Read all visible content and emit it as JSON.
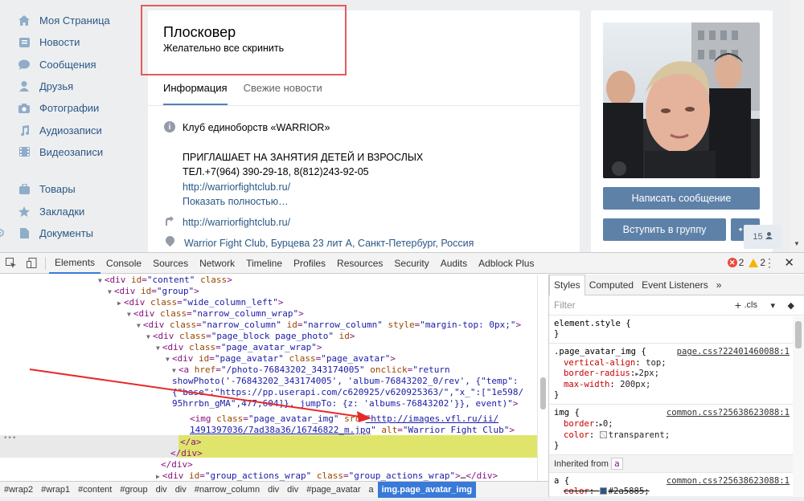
{
  "sidebar": {
    "items": [
      {
        "label": "Моя Страница",
        "icon": "home-icon"
      },
      {
        "label": "Новости",
        "icon": "news-icon"
      },
      {
        "label": "Сообщения",
        "icon": "messages-icon"
      },
      {
        "label": "Друзья",
        "icon": "friends-icon"
      },
      {
        "label": "Фотографии",
        "icon": "camera-icon"
      },
      {
        "label": "Аудиозаписи",
        "icon": "music-icon"
      },
      {
        "label": "Видеозаписи",
        "icon": "video-icon"
      }
    ],
    "items2": [
      {
        "label": "Товары",
        "icon": "bag-icon"
      },
      {
        "label": "Закладки",
        "icon": "star-icon"
      },
      {
        "label": "Документы",
        "icon": "document-icon"
      }
    ]
  },
  "group": {
    "title": "Плосковер",
    "status": "Желательно все скринить",
    "tabs": [
      "Информация",
      "Свежие новости"
    ],
    "info_title": "Клуб единоборств «WARRIOR»",
    "info_line1": "ПРИГЛАШАЕТ НА ЗАНЯТИЯ ДЕТЕЙ И ВЗРОСЛЫХ",
    "info_line2": "ТЕЛ.+7(964) 390-29-18, 8(812)243-92-05",
    "info_link": "http://warriorfightclub.ru/",
    "show_more": "Показать полностью…",
    "site_link": "http://warriorfightclub.ru/",
    "address": "Warrior Fight Club, Бурцева 23 лит А, Санкт-Петербург, Россия"
  },
  "right": {
    "message_button": "Написать сообщение",
    "join_button": "Вступить в группу",
    "count": "15"
  },
  "devtools": {
    "tabs": [
      "Elements",
      "Console",
      "Sources",
      "Network",
      "Timeline",
      "Profiles",
      "Resources",
      "Security",
      "Audits",
      "Adblock Plus"
    ],
    "errors": "2",
    "warnings": "2",
    "breadcrumbs": [
      "#wrap2",
      "#wrap1",
      "#content",
      "#group",
      "div",
      "div",
      "#narrow_column",
      "div",
      "div",
      "#page_avatar",
      "a",
      "img.page_avatar_img"
    ],
    "styles_tabs": [
      "Styles",
      "Computed",
      "Event Listeners"
    ],
    "filter_placeholder": "Filter",
    "cls_label": ".cls",
    "rule_element_style": "element.style {",
    "rule1_selector": ".page_avatar_img {",
    "rule1_source": "page.css?22401460088:1",
    "rule1_props": [
      {
        "name": "vertical-align",
        "value": "top;"
      },
      {
        "name": "border-radius",
        "value": "2px;"
      },
      {
        "name": "max-width",
        "value": "200px;"
      }
    ],
    "rule2_selector": "img {",
    "rule2_source": "common.css?25638623088:1",
    "rule2_props": [
      {
        "name": "border",
        "value": "0;"
      },
      {
        "name": "color",
        "value": "transparent;"
      }
    ],
    "inherited_label": "Inherited from",
    "inherited_chip": "a",
    "rule3_selector": "a {",
    "rule3_source": "common.css?25638623088:1",
    "rule3_prop_name": "color",
    "rule3_prop_value": "#2a5885;",
    "accent_color": "#3879d9"
  }
}
